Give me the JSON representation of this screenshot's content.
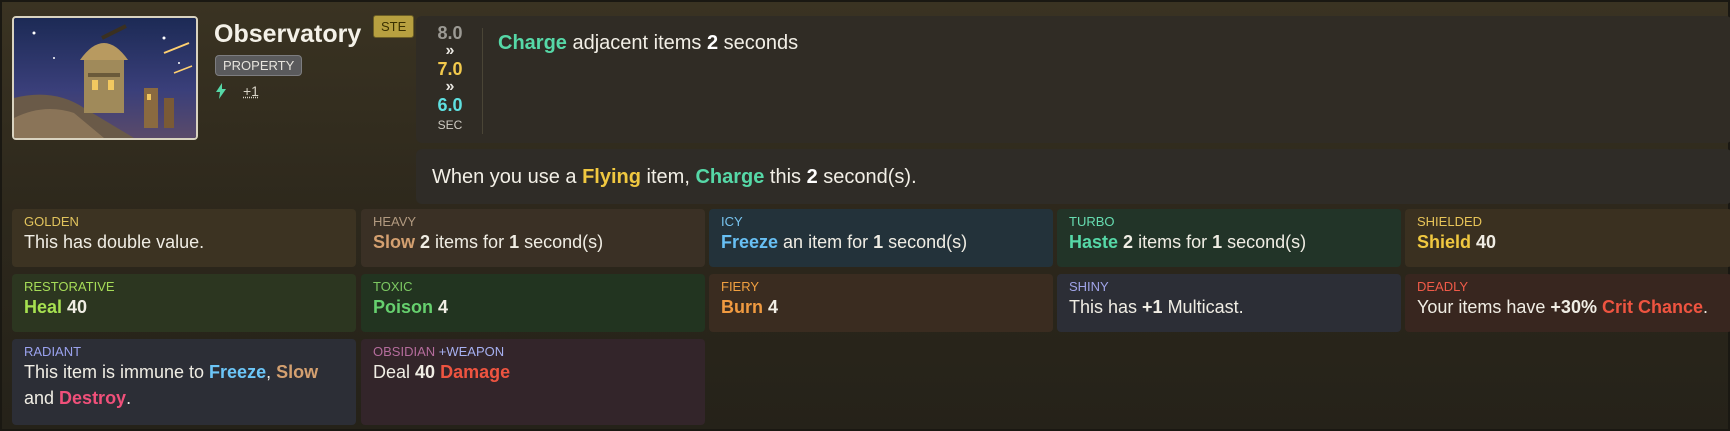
{
  "item": {
    "name": "Observatory",
    "rarity_badge": "STE",
    "tag": "PROPERTY",
    "stat_icon": "lightning-icon",
    "stat_value": "+1"
  },
  "cooldown": {
    "old": "8.0",
    "arrow": "»",
    "mid": "7.0",
    "new": "6.0",
    "unit": "SEC"
  },
  "abilities": {
    "a1": {
      "kw": "Charge",
      "t1": " adjacent items ",
      "n": "2",
      "t2": " seconds"
    },
    "a2": {
      "t0": "When you use a ",
      "kw1": "Flying",
      "t1": " item, ",
      "kw2": "Charge",
      "t2": " this ",
      "n": "2",
      "t3": " second(s)."
    }
  },
  "enchantments": [
    {
      "label": "GOLDEN",
      "text": "This has double value."
    },
    {
      "label": "HEAVY",
      "kw": "Slow",
      "n": "2",
      "t1": " items for ",
      "n2": "1",
      "t2": " second(s)"
    },
    {
      "label": "ICY",
      "kw": "Freeze",
      "t1": " an item for ",
      "n": "1",
      "t2": " second(s)"
    },
    {
      "label": "TURBO",
      "kw": "Haste",
      "n": "2",
      "t1": " items for ",
      "n2": "1",
      "t2": " second(s)"
    },
    {
      "label": "SHIELDED",
      "kw": "Shield",
      "n": "40"
    },
    {
      "label": "RESTORATIVE",
      "kw": "Heal",
      "n": "40"
    },
    {
      "label": "TOXIC",
      "kw": "Poison",
      "n": "4"
    },
    {
      "label": "FIERY",
      "kw": "Burn",
      "n": "4"
    },
    {
      "label": "SHINY",
      "t0": "This has ",
      "n": "+1",
      "t1": " Multicast."
    },
    {
      "label": "DEADLY",
      "t0": "Your items have ",
      "n": "+30%",
      "kw": "Crit Chance",
      "t1": "."
    },
    {
      "label": "RADIANT",
      "t0": "This item is immune to ",
      "kw1": "Freeze",
      "sep": ", ",
      "kw2": "Slow",
      "t1": "and ",
      "kw3": "Destroy",
      "t2": "."
    },
    {
      "label": "OBSIDIAN",
      "label2": "+WEAPON",
      "t0": "Deal ",
      "n": "40",
      "kw": "Damage"
    }
  ]
}
